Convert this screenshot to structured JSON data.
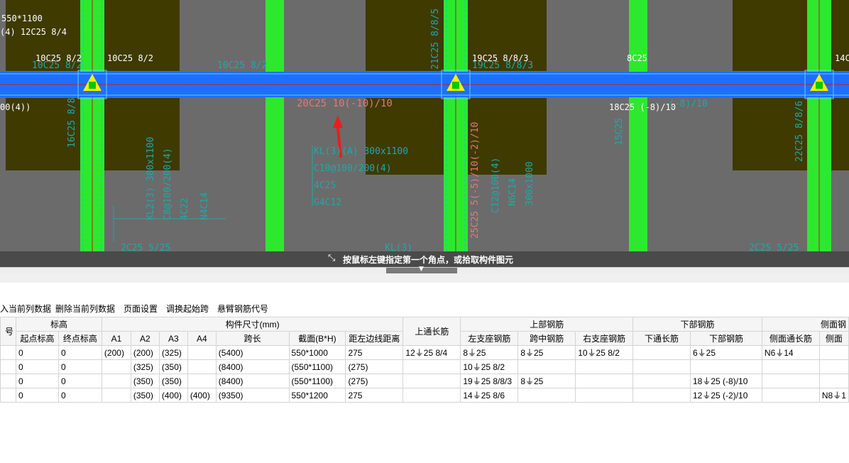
{
  "cad": {
    "labels_white": [
      "550*1100",
      "(4) 12C25 8/4",
      "10C25 8/2",
      "10C25 8/2",
      "19C25 8/8/3",
      "8C25",
      "14C",
      "00(4))",
      "18C25 (-8)/10"
    ],
    "labels_cyan": [
      "10C25 8/2",
      "10C25 8/2",
      "19C25 8/8/3",
      "(-8)/10",
      "21C25 8/8/5",
      "16C25 8/8",
      "22C25 8/8/6",
      "15C25",
      "KL2(3) 300x1100",
      "C8@100/200(4)",
      "4C22",
      "N4C14",
      "KL(3)(A) 300x1100",
      "C10@100/200(4)",
      "4C25",
      "G4C12",
      "C12@100(4)",
      "N6C14",
      "300x1000",
      "2C25 5/25",
      "KL(3)",
      "2C25 5/25"
    ],
    "labels_red": [
      "20C25 10(-10)/10",
      "25C25 5(-5)/10(-2)/10"
    ],
    "status_text": "按鼠标左键指定第一个角点，或拾取构件图元",
    "status_icon": "corner-pick-icon"
  },
  "toolbar": {
    "items": [
      "入当前列数据",
      "删除当前列数据",
      "页面设置",
      "调换起始跨",
      "悬臂钢筋代号"
    ]
  },
  "table": {
    "group_headers": [
      "号",
      "标高",
      "构件尺寸(mm)",
      "上通长筋",
      "上部钢筋",
      "下部钢筋",
      "侧面钢"
    ],
    "sub_headers": [
      "起点标高",
      "终点标高",
      "A1",
      "A2",
      "A3",
      "A4",
      "跨长",
      "截面(B*H)",
      "距左边线距离",
      "左支座钢筋",
      "跨中钢筋",
      "右支座钢筋",
      "下通长筋",
      "下部钢筋",
      "侧面通长筋",
      "侧面"
    ],
    "rows": [
      [
        "",
        "0",
        "0",
        "(200)",
        "(200)",
        "(325)",
        "",
        "(5400)",
        "550*1000",
        "275",
        "12⏚25 8/4",
        "8⏚25",
        "8⏚25",
        "10⏚25 8/2",
        "",
        "6⏚25",
        "N6⏚14",
        ""
      ],
      [
        "",
        "0",
        "0",
        "",
        "(325)",
        "(350)",
        "",
        "(8400)",
        "(550*1100)",
        "(275)",
        "",
        "10⏚25 8/2",
        "",
        "",
        "",
        "",
        "",
        ""
      ],
      [
        "",
        "0",
        "0",
        "",
        "(350)",
        "(350)",
        "",
        "(8400)",
        "(550*1100)",
        "(275)",
        "",
        "19⏚25 8/8/3",
        "8⏚25",
        "",
        "",
        "18⏚25 (-8)/10",
        "",
        ""
      ],
      [
        "",
        "0",
        "0",
        "",
        "(350)",
        "(400)",
        "(400)",
        "(9350)",
        "550*1200",
        "275",
        "",
        "14⏚25 8/6",
        "",
        "",
        "",
        "12⏚25 (-2)/10",
        "",
        "N8⏚1"
      ]
    ]
  },
  "colors": {
    "canvas_bg": "#6b6b6b",
    "column_green": "#2ee82e",
    "beam_blue": "#1e6fff",
    "slab_olive": "#3e3a00",
    "rebar_cyan": "#1fa8a8",
    "annotation_red": "#e07a7a",
    "marker_yellow": "#ffee00"
  }
}
